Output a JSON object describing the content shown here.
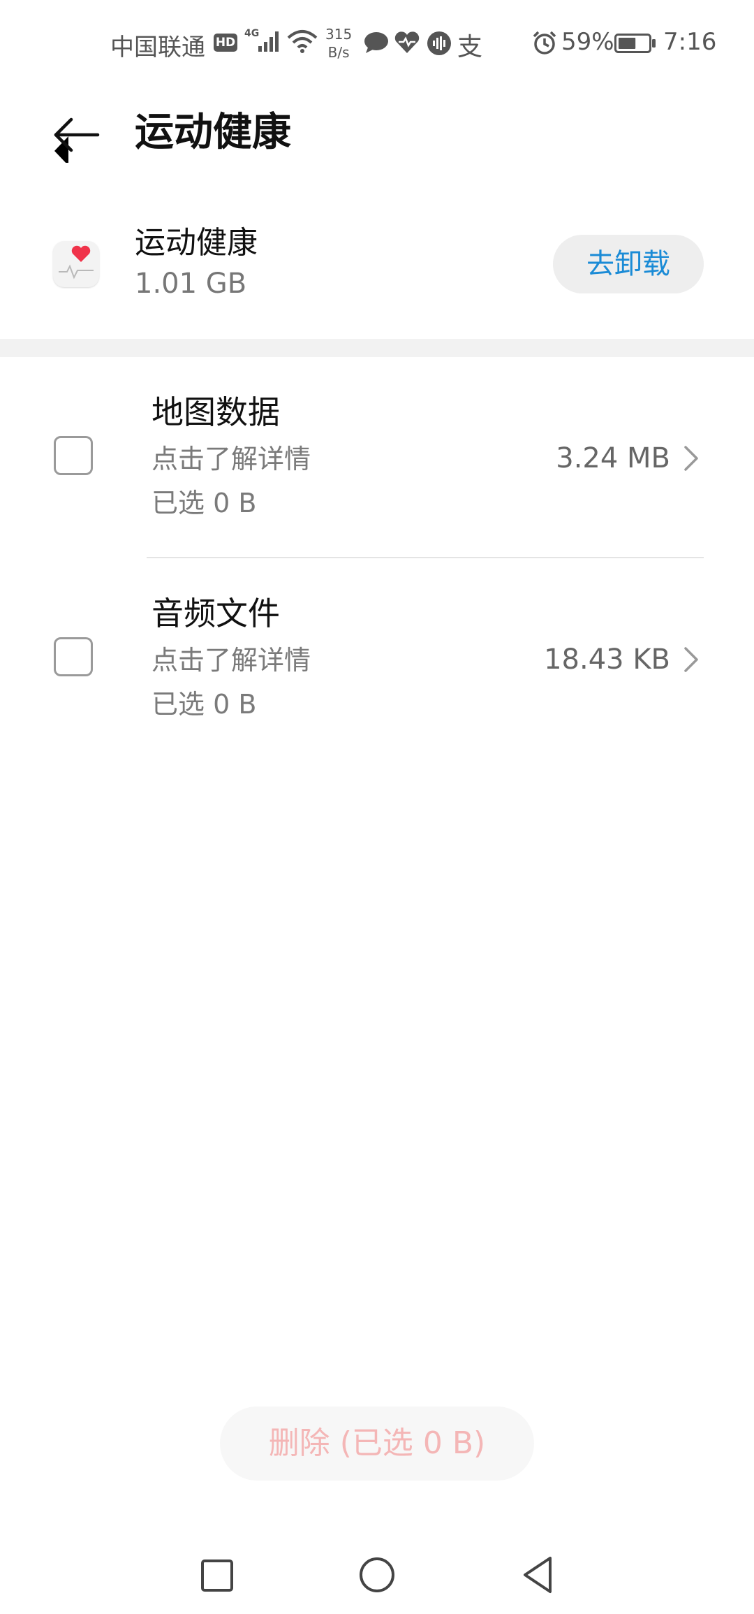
{
  "status_bar": {
    "carrier": "中国联通",
    "hd_label": "HD",
    "network_type": "4G",
    "net_speed_value": "315",
    "net_speed_unit": "B/s",
    "battery_percent": "59%",
    "battery_level": 0.59,
    "time": "7:16",
    "alipay_glyph": "支",
    "icons": [
      "signal-icon",
      "wifi-icon",
      "chat-icon",
      "health-heart-icon",
      "audio-wave-icon",
      "alipay-icon",
      "alarm-icon",
      "battery-icon"
    ]
  },
  "header": {
    "back_icon": "back-arrow-icon",
    "title": "运动健康"
  },
  "app_info": {
    "icon": "health-app-icon",
    "name": "运动健康",
    "size": "1.01 GB",
    "uninstall_label": "去卸载"
  },
  "items": [
    {
      "title": "地图数据",
      "description": "点击了解详情",
      "selected": "已选 0 B",
      "size": "3.24 MB",
      "checked": false
    },
    {
      "title": "音频文件",
      "description": "点击了解详情",
      "selected": "已选 0 B",
      "size": "18.43 KB",
      "checked": false
    }
  ],
  "delete_button": {
    "label": "删除 (已选 0 B)",
    "enabled": false
  },
  "nav_bar": {
    "icons": [
      "recent-apps-icon",
      "home-icon",
      "back-icon"
    ]
  },
  "colors": {
    "accent": "#1a8bd6",
    "delete_disabled": "#f4b6b6",
    "heart": "#f0334a"
  }
}
